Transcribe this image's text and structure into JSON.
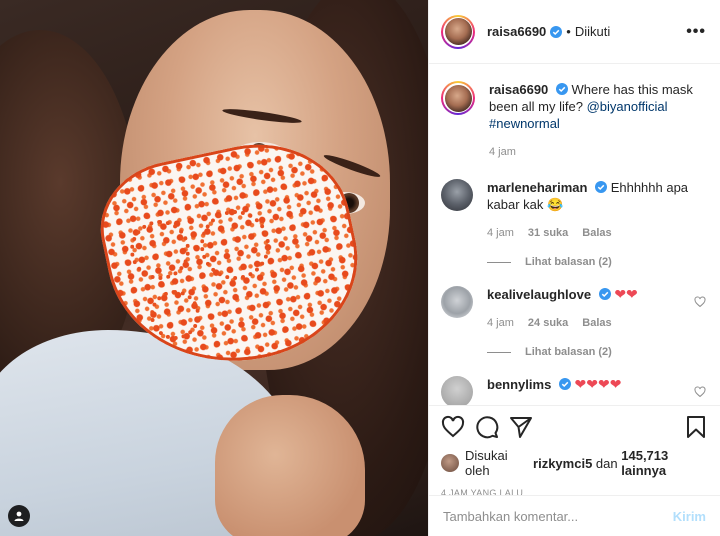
{
  "post": {
    "username": "raisa6690",
    "follow_status": "Diikuti",
    "separator": "•",
    "more_label": "•••",
    "tag_icon": "user-tag-icon"
  },
  "caption": {
    "username": "raisa6690",
    "text": "Where has this mask been all my life?",
    "mention": "@biyanofficial",
    "hashtag": "#newnormal",
    "time": "4 jam"
  },
  "comments": [
    {
      "username": "marlenehariman",
      "text": "Ehhhhhh apa kabar kak 😂",
      "time": "4 jam",
      "likes": "31 suka",
      "reply_label": "Balas",
      "view_replies": "Lihat balasan (2)"
    },
    {
      "username": "kealivelaughlove",
      "text": "❤❤",
      "time": "4 jam",
      "likes": "24 suka",
      "reply_label": "Balas",
      "view_replies": "Lihat balasan (2)"
    },
    {
      "username": "bennylims",
      "text": "❤❤❤❤"
    }
  ],
  "likes": {
    "prefix": "Disukai oleh",
    "user": "rizkymci5",
    "conjunction": "dan",
    "count": "145,713 lainnya"
  },
  "timestamp": "4 JAM YANG LALU",
  "add_comment": {
    "placeholder": "Tambahkan komentar...",
    "post_label": "Kirim"
  },
  "colors": {
    "verified": "#3897f0",
    "heart_red": "#ed4956",
    "link": "#00376b",
    "post_disabled": "#b2dffc"
  }
}
